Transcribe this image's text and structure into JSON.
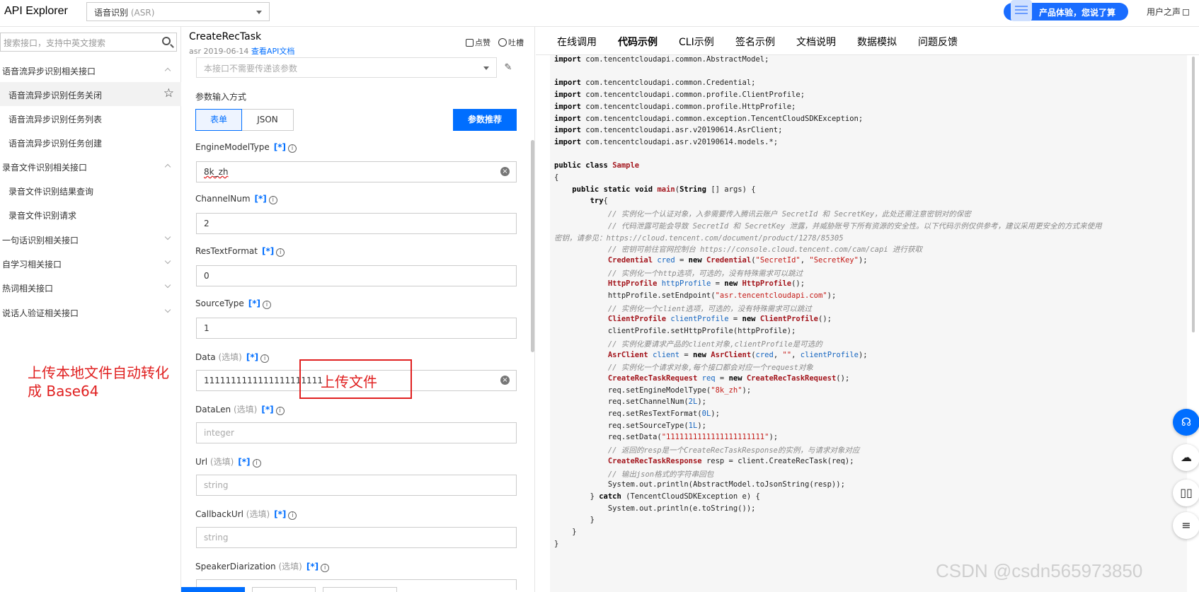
{
  "header": {
    "brand": "API Explorer",
    "product": "语音识别",
    "product_hint": "(ASR)",
    "promo": "产品体验，您说了算",
    "user_voice": "用户之声"
  },
  "sidebar": {
    "search_placeholder": "搜索接口，支持中英文搜索",
    "groups": [
      {
        "label": "语音流异步识别相关接口",
        "expanded": true
      },
      {
        "label": "录音文件识别相关接口",
        "expanded": true
      },
      {
        "label": "一句话识别相关接口",
        "expanded": false
      },
      {
        "label": "自学习相关接口",
        "expanded": false
      },
      {
        "label": "热词相关接口",
        "expanded": false
      },
      {
        "label": "说话人验证相关接口",
        "expanded": false
      }
    ],
    "items": [
      {
        "label": "语音流异步识别任务关闭",
        "active": true
      },
      {
        "label": "语音流异步识别任务列表",
        "active": false
      },
      {
        "label": "语音流异步识别任务创建",
        "active": false
      },
      {
        "label": "录音文件识别结果查询",
        "active": false
      },
      {
        "label": "录音文件识别请求",
        "active": false
      }
    ],
    "annotation": "上传本地文件自动转化成 Base64"
  },
  "api": {
    "name": "CreateRecTask",
    "meta": "asr 2019-06-14",
    "doc_link": "查看API文档",
    "like": "点赞",
    "complain": "吐槽",
    "region_placeholder": "本接口不需要传递该参数",
    "input_mode_label": "参数输入方式",
    "mode_form": "表单",
    "mode_json": "JSON",
    "recommend": "参数推荐",
    "required_mark": "[*]",
    "optional_mark": "(选填)",
    "upload_annotation": "上传文件",
    "fields": [
      {
        "name": "EngineModelType",
        "value": "8k_zh",
        "optional": false
      },
      {
        "name": "ChannelNum",
        "value": "2",
        "optional": false
      },
      {
        "name": "ResTextFormat",
        "value": "0",
        "optional": false
      },
      {
        "name": "SourceType",
        "value": "1",
        "optional": false
      },
      {
        "name": "Data",
        "value": "1111111111111111111111",
        "optional": true
      },
      {
        "name": "DataLen",
        "placeholder": "integer",
        "optional": true
      },
      {
        "name": "Url",
        "placeholder": "string",
        "optional": true
      },
      {
        "name": "CallbackUrl",
        "placeholder": "string",
        "optional": true
      },
      {
        "name": "SpeakerDiarization",
        "optional": true
      }
    ]
  },
  "tabs": [
    "在线调用",
    "代码示例",
    "CLI示例",
    "签名示例",
    "文档说明",
    "数据模拟",
    "问题反馈"
  ],
  "active_tab": "代码示例",
  "code_lines": [
    "import com.tencentcloudapi.common.AbstractModel;",
    "",
    "import com.tencentcloudapi.common.Credential;",
    "import com.tencentcloudapi.common.profile.ClientProfile;",
    "import com.tencentcloudapi.common.profile.HttpProfile;",
    "import com.tencentcloudapi.common.exception.TencentCloudSDKException;",
    "import com.tencentcloudapi.asr.v20190614.AsrClient;",
    "import com.tencentcloudapi.asr.v20190614.models.*;",
    "",
    "public class Sample",
    "{",
    "    public static void main(String [] args) {",
    "        try{",
    "            // 实例化一个认证对象，入参需要传入腾讯云账户 SecretId 和 SecretKey，此处还需注意密钥对的保密",
    "            // 代码泄露可能会导致 SecretId 和 SecretKey 泄露，并威胁账号下所有资源的安全性。以下代码示例仅供参考，建议采用更安全的方式来使用",
    "密钥，请参见：https://cloud.tencent.com/document/product/1278/85305",
    "            // 密钥可前往官网控制台 https://console.cloud.tencent.com/cam/capi 进行获取",
    "            Credential cred = new Credential(\"SecretId\", \"SecretKey\");",
    "            // 实例化一个http选项，可选的，没有特殊需求可以跳过",
    "            HttpProfile httpProfile = new HttpProfile();",
    "            httpProfile.setEndpoint(\"asr.tencentcloudapi.com\");",
    "            // 实例化一个client选项，可选的，没有特殊需求可以跳过",
    "            ClientProfile clientProfile = new ClientProfile();",
    "            clientProfile.setHttpProfile(httpProfile);",
    "            // 实例化要请求产品的client对象,clientProfile是可选的",
    "            AsrClient client = new AsrClient(cred, \"\", clientProfile);",
    "            // 实例化一个请求对象,每个接口都会对应一个request对象",
    "            CreateRecTaskRequest req = new CreateRecTaskRequest();",
    "            req.setEngineModelType(\"8k_zh\");",
    "            req.setChannelNum(2L);",
    "            req.setResTextFormat(0L);",
    "            req.setSourceType(1L);",
    "            req.setData(\"1111111111111111111111\");",
    "            // 返回的resp是一个CreateRecTaskResponse的实例，与请求对象对应",
    "            CreateRecTaskResponse resp = client.CreateRecTask(req);",
    "            // 输出json格式的字符串回包",
    "            System.out.println(AbstractModel.toJsonString(resp));",
    "        } catch (TencentCloudSDKException e) {",
    "            System.out.println(e.toString());",
    "        }",
    "    }",
    "}"
  ],
  "watermark": "CSDN @csdn565973850"
}
